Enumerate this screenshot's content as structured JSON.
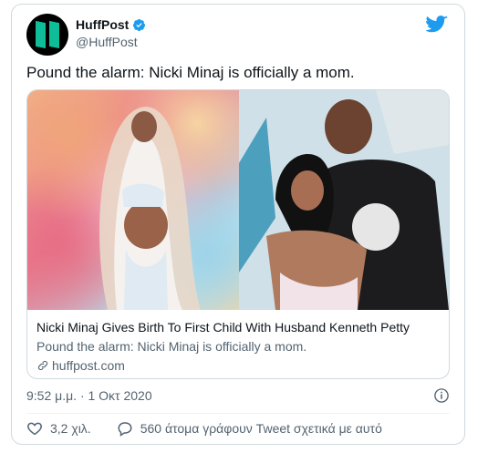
{
  "account": {
    "display_name": "HuffPost",
    "handle": "@HuffPost",
    "avatar_icon": "huffpost-logo-icon",
    "verified_icon": "verified-badge-icon"
  },
  "tweet": {
    "text": "Pound the alarm: Nicki Minaj is officially a mom.",
    "timestamp": "9:52 μ.μ. · 1 Οκτ 2020"
  },
  "card": {
    "title": "Nicki Minaj Gives Birth To First Child With Husband Kenneth Petty",
    "description": "Pound the alarm: Nicki Minaj is officially a mom.",
    "domain": "huffpost.com",
    "left_image": "portrait-photo",
    "right_image": "couple-photo"
  },
  "actions": {
    "like_count": "3,2 χιλ.",
    "reply_text": "560 άτομα γράφουν Tweet σχετικά με αυτό"
  },
  "colors": {
    "brand_blue": "#1d9bf0",
    "text_primary": "#0f1419",
    "text_secondary": "#536471",
    "border": "#cfd9de",
    "huffpost_green": "#0dbe98"
  }
}
